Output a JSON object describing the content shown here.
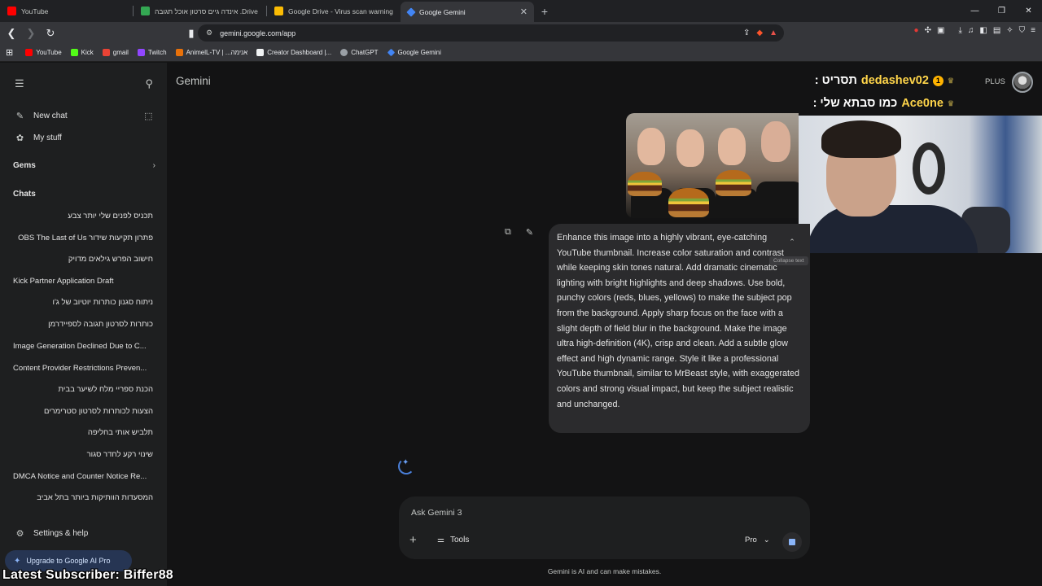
{
  "browser": {
    "tabs": [
      {
        "title": "YouTube",
        "favicon_color": "#ff0000",
        "active": false
      },
      {
        "title": "אינדה גיים סרטון אוכל תגובה .Drive",
        "favicon_color": "#34a853",
        "active": false
      },
      {
        "title": "Google Drive - Virus scan warning",
        "favicon_color": "#fbbc04",
        "active": false
      },
      {
        "title": "Google Gemini",
        "favicon_color": "#4285f4",
        "active": true
      }
    ],
    "url": "gemini.google.com/app",
    "bookmarks": [
      {
        "label": "YouTube",
        "color": "#ff0000"
      },
      {
        "label": "Kick",
        "color": "#53fc18"
      },
      {
        "label": "gmail",
        "color": "#ea4335"
      },
      {
        "label": "Twitch",
        "color": "#9146ff"
      },
      {
        "label": "AnimelL-TV | ...אנימה",
        "color": "#e8710a"
      },
      {
        "label": "Creator Dashboard |...",
        "color": "#f1f3f4"
      },
      {
        "label": "ChatGPT",
        "color": "#9aa0a6"
      },
      {
        "label": "Google Gemini",
        "color": "#4285f4"
      }
    ]
  },
  "sidebar": {
    "new_chat": "New chat",
    "my_stuff": "My stuff",
    "gems": "Gems",
    "chats_heading": "Chats",
    "chats": [
      {
        "label": "תכניס לפנים שלי יותר צבע",
        "rtl": true
      },
      {
        "label": "פתרון תקיעות שידור OBS The Last of Us",
        "rtl": true
      },
      {
        "label": "חישוב הפרש גילאים מדויק",
        "rtl": true
      },
      {
        "label": "Kick Partner Application Draft",
        "rtl": false
      },
      {
        "label": "ניתוח סגנון כותרות יוטיוב של ג'ו",
        "rtl": true
      },
      {
        "label": "כותרות לסרטון תגובה לספיידרמן",
        "rtl": true
      },
      {
        "label": "Image Generation Declined Due to C...",
        "rtl": false
      },
      {
        "label": "Content Provider Restrictions Preven...",
        "rtl": false
      },
      {
        "label": "הכנת ספריי מלח לשיער בבית",
        "rtl": true
      },
      {
        "label": "הצעות לכותרות לסרטון סטרימרים",
        "rtl": true
      },
      {
        "label": "תלביש אותי בחליפה",
        "rtl": true
      },
      {
        "label": "שינוי רקע לחדר סגור",
        "rtl": true
      },
      {
        "label": "DMCA Notice and Counter Notice Re...",
        "rtl": false
      },
      {
        "label": "המסעדות הוותיקות ביותר בתל אביב",
        "rtl": true
      }
    ],
    "settings": "Settings & help",
    "upgrade": "Upgrade to Google AI Pro"
  },
  "main": {
    "title": "Gemini",
    "plan_badge": "PLUS",
    "user_message": "Enhance this image into a highly vibrant, eye-catching YouTube thumbnail. Increase color saturation and contrast while keeping skin tones natural. Add dramatic cinematic lighting with bright highlights and deep shadows. Use bold, punchy colors (reds, blues, yellows) to make the subject pop from the background. Apply sharp focus on the face with a slight depth of field blur in the background. Make the image ultra high-definition (4K), crisp and clean. Add a subtle glow effect and high dynamic range. Style it like a professional YouTube thumbnail, similar to MrBeast style, with exaggerated colors and strong visual impact, but keep the subject realistic and unchanged.",
    "collapse_tooltip": "Collapse text",
    "input_placeholder": "Ask Gemini 3",
    "tools_label": "Tools",
    "mode_label": "Pro",
    "disclaimer": "Gemini is AI and can make mistakes."
  },
  "stream_overlay": {
    "line1_user": "dedashev02",
    "line1_text": "תסריט :",
    "line1_badge": "1",
    "line2_user": "Ace0ne",
    "line2_text": "כמו סבתא שלי :",
    "subscriber": "Latest Subscriber: Biffer88"
  },
  "colors": {
    "accent": "#8ab4f8",
    "overlay_name": "#ffd54a"
  }
}
